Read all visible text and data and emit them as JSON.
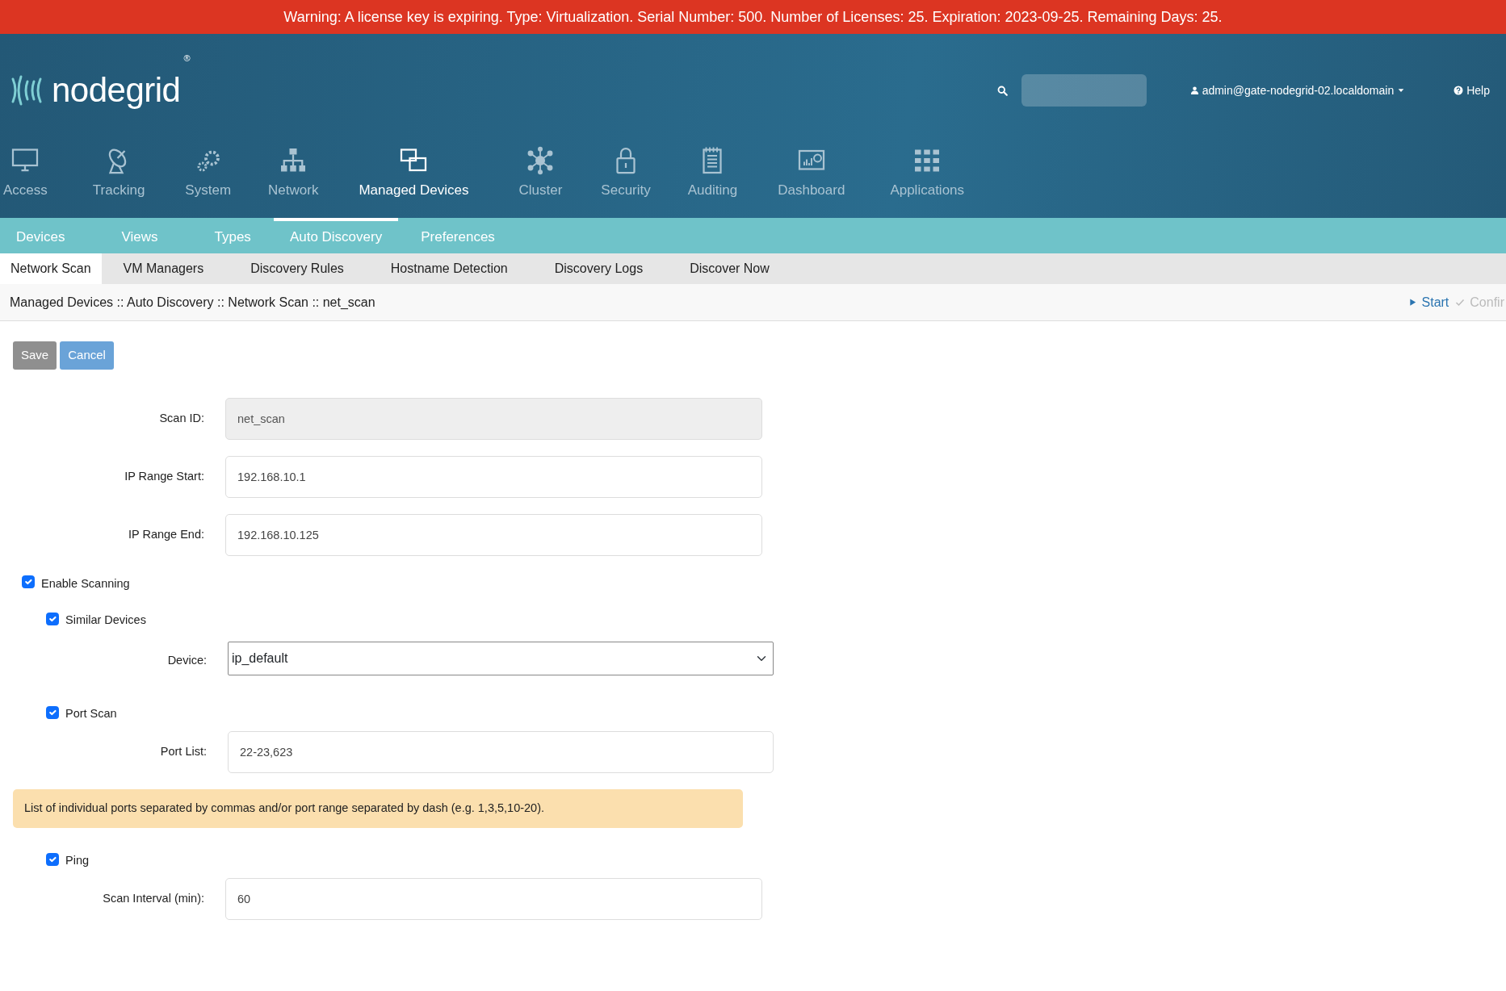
{
  "warning": "Warning: A license key is expiring. Type: Virtualization. Serial Number: 500. Number of Licenses: 25. Expiration: 2023-09-25. Remaining Days: 25.",
  "logo": {
    "text": "nodegrid",
    "mark": "®"
  },
  "user": "admin@gate-nodegrid-02.localdomain",
  "help": "Help",
  "main_nav": [
    {
      "label": "Access",
      "selected": false
    },
    {
      "label": "Tracking",
      "selected": false
    },
    {
      "label": "System",
      "selected": false
    },
    {
      "label": "Network",
      "selected": false
    },
    {
      "label": "Managed Devices",
      "selected": true
    },
    {
      "label": "Cluster",
      "selected": false
    },
    {
      "label": "Security",
      "selected": false
    },
    {
      "label": "Auditing",
      "selected": false
    },
    {
      "label": "Dashboard",
      "selected": false
    },
    {
      "label": "Applications",
      "selected": false
    }
  ],
  "sub_nav": [
    {
      "label": "Devices",
      "selected": false
    },
    {
      "label": "Views",
      "selected": false
    },
    {
      "label": "Types",
      "selected": false
    },
    {
      "label": "Auto Discovery",
      "selected": true
    },
    {
      "label": "Preferences",
      "selected": false
    }
  ],
  "section_tabs": [
    {
      "label": "Network Scan",
      "selected": true
    },
    {
      "label": "VM Managers",
      "selected": false
    },
    {
      "label": "Discovery Rules",
      "selected": false
    },
    {
      "label": "Hostname Detection",
      "selected": false
    },
    {
      "label": "Discovery Logs",
      "selected": false
    },
    {
      "label": "Discover Now",
      "selected": false
    }
  ],
  "breadcrumb": "Managed Devices :: Auto Discovery :: Network Scan :: net_scan",
  "actions": [
    {
      "label": "Start",
      "disabled": false
    },
    {
      "label": "Confir",
      "disabled": true
    }
  ],
  "buttons": [
    {
      "label": "Save",
      "disabled": true
    },
    {
      "label": "Cancel",
      "disabled": false
    }
  ],
  "form": [
    {
      "kind": "input",
      "label": "Scan ID:",
      "value": "net_scan",
      "disabled": true
    },
    {
      "kind": "input",
      "label": "IP Range Start:",
      "value": "192.168.10.1",
      "disabled": false
    },
    {
      "kind": "input",
      "label": "IP Range End:",
      "value": "192.168.10.125",
      "disabled": false
    },
    {
      "kind": "checkbox",
      "label": "Enable Scanning",
      "checked": true,
      "children": [
        {
          "kind": "checkbox",
          "label": "Similar Devices",
          "checked": true
        },
        {
          "kind": "select",
          "label": "Device:",
          "value": "ip_default"
        },
        {
          "kind": "checkbox",
          "label": "Port Scan",
          "checked": true
        },
        {
          "kind": "input",
          "label": "Port List:",
          "value": "22-23,623",
          "disabled": false
        },
        {
          "kind": "note",
          "text": "List of individual ports separated by commas and/or port range separated by dash (e.g. 1,3,5,10-20)."
        },
        {
          "kind": "checkbox",
          "label": "Ping",
          "checked": true
        }
      ]
    },
    {
      "kind": "input",
      "label": "Scan Interval (min):",
      "value": "60",
      "disabled": false
    }
  ]
}
